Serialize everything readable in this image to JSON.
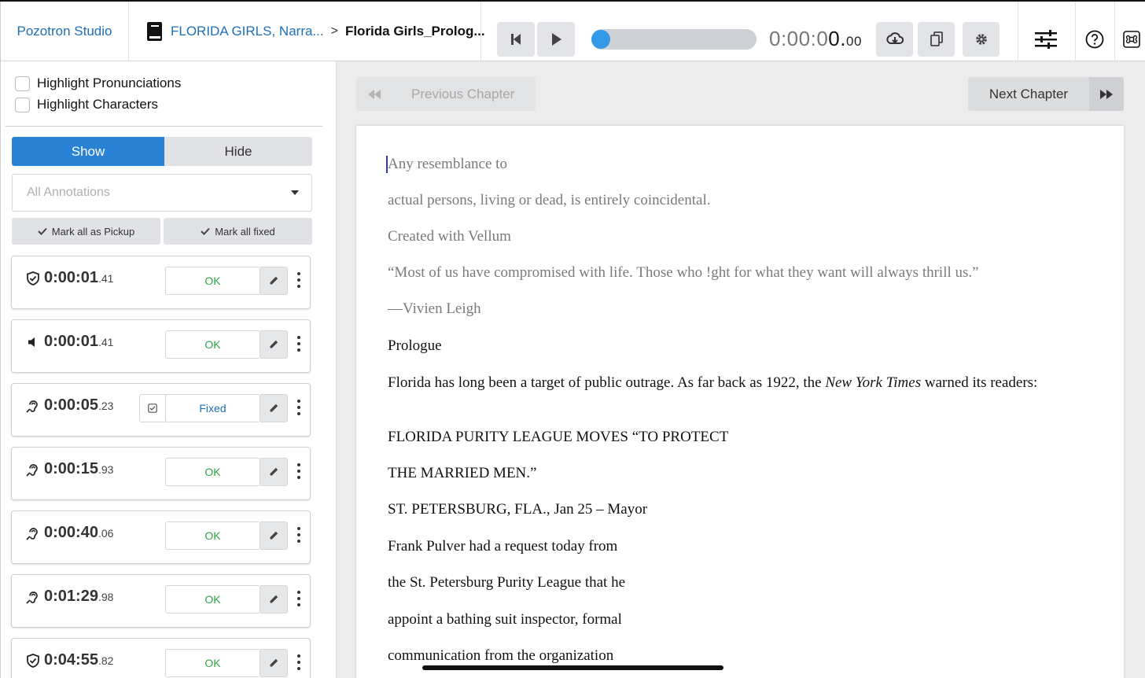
{
  "app": {
    "brand": "Pozotron Studio"
  },
  "breadcrumb": {
    "book": "FLORIDA GIRLS, Narra...",
    "separator": ">",
    "chapter": "Florida Girls_Prolog..."
  },
  "player": {
    "progress": 0,
    "timecode_dim": "0:00:0",
    "timecode_main": "0.",
    "timecode_frac": "00"
  },
  "sidebar": {
    "highlight_pronunciations": "Highlight Pronunciations",
    "highlight_characters": "Highlight Characters",
    "show_label": "Show",
    "hide_label": "Hide",
    "filter_placeholder": "All Annotations",
    "mark_pickup_label": "Mark all as Pickup",
    "mark_fixed_label": "Mark all fixed",
    "annotations": [
      {
        "icon": "shield-check-icon",
        "time": "0:00:01",
        "frac": ".41",
        "status": "OK"
      },
      {
        "icon": "speaker-icon",
        "time": "0:00:01",
        "frac": ".41",
        "status": "OK"
      },
      {
        "icon": "ear-icon",
        "time": "0:00:05",
        "frac": ".23",
        "status": "Fixed"
      },
      {
        "icon": "ear-icon",
        "time": "0:00:15",
        "frac": ".93",
        "status": "OK"
      },
      {
        "icon": "ear-icon",
        "time": "0:00:40",
        "frac": ".06",
        "status": "OK"
      },
      {
        "icon": "ear-icon",
        "time": "0:01:29",
        "frac": ".98",
        "status": "OK"
      },
      {
        "icon": "shield-check-icon",
        "time": "0:04:55",
        "frac": ".82",
        "status": "OK"
      }
    ]
  },
  "main": {
    "prev_chapter": "Previous Chapter",
    "next_chapter": "Next Chapter",
    "text": {
      "p1": "Any resemblance to",
      "p2": "actual persons, living or dead, is entirely coincidental.",
      "p3": "Created with Vellum",
      "p4": "“Most of us have compromised with life. Those who !ght for what they want will always thrill us.”",
      "p5": "—Vivien Leigh",
      "p6": "Prologue",
      "p7a": "Florida has long been a target of public outrage. As far back as 1922, the ",
      "p7b": "New York Times",
      "p7c": " warned its readers:",
      "p8": "FLORIDA PURITY LEAGUE MOVES “TO PROTECT",
      "p9": "THE MARRIED MEN.”",
      "p10": "ST. PETERSBURG, FLA., Jan 25 – Mayor",
      "p11": "Frank Pulver had a request today from",
      "p12": "the St. Petersburg Purity League that he",
      "p13": "appoint a bathing suit inspector, formal",
      "p14": "communication from the organization"
    }
  },
  "colors": {
    "accent": "#2a82d6",
    "link": "#1d6fb8",
    "ok": "#2fa54a",
    "knob": "#3399e6"
  }
}
